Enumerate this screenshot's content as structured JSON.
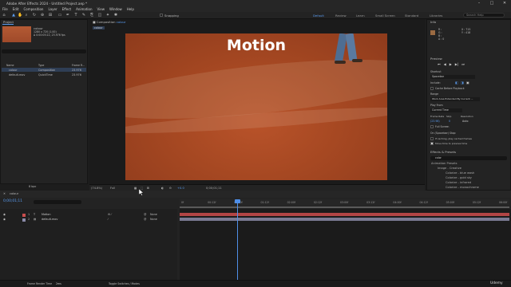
{
  "window": {
    "title": "Adobe After Effects 2024 - Untitled Project.aep *"
  },
  "menu": [
    "File",
    "Edit",
    "Composition",
    "Layer",
    "Effect",
    "Animation",
    "View",
    "Window",
    "Help"
  ],
  "toolbar": {
    "snapping": "Snapping",
    "workspaces": [
      "Default",
      "Review",
      "Learn",
      "Small Screen",
      "Standard",
      "Libraries"
    ],
    "active_workspace": "Default",
    "search_help": "Search Help"
  },
  "project": {
    "title": "Project",
    "comp_name": "colour",
    "comp_info_1": "1280 x 720 (1.00)",
    "comp_info_2": "Δ 0:00:05:22, 23.976 fps",
    "columns": [
      "Name",
      "Type",
      "Frame R..."
    ],
    "items": [
      {
        "name": "colour",
        "type": "Composition",
        "fps": "23.976"
      },
      {
        "name": "default.mov",
        "type": "QuickTime",
        "fps": "23.976"
      }
    ],
    "bpc": "8 bpc"
  },
  "composition": {
    "tab": "Composition",
    "comp_name": "colour",
    "crumb": "colour",
    "overlay_text": "Motion"
  },
  "viewer": {
    "zoom": "(74.8%)",
    "quality": "Full",
    "timecode": "0;00;01;11",
    "exposure": "+0.0"
  },
  "info": {
    "title": "Info",
    "r": "R :",
    "g": "G :",
    "b": "B :",
    "a": "A : 0",
    "x": "X : 715",
    "y": "Y : 418"
  },
  "preview": {
    "title": "Preview",
    "shortcut_label": "Shortcut",
    "shortcut_value": "Spacebar",
    "include": "Include:",
    "cache": "Cache Before Playback",
    "range_label": "Range",
    "range_value": "Work Area Extended By Current ...",
    "play_from_label": "Play From",
    "play_from_value": "Current Time",
    "frame_rate_label": "Frame Rate",
    "skip_label": "Skip",
    "resolution_label": "Resolution",
    "frame_rate": "(23.98)",
    "skip": "0",
    "resolution": "Auto",
    "full_screen": "Full Screen",
    "on_stop": "On (Spacebar) Stop:",
    "if_caching": "If caching, play cached frames",
    "move_time": "Move time to preview time"
  },
  "effects": {
    "title": "Effects & Presets",
    "search": "color",
    "tree": [
      "Animation Presets",
      "Image - Creative",
      "Colorize - blue wash",
      "Colorize - gold sky",
      "Colorize - infrared",
      "Colorize - monochrome"
    ]
  },
  "timeline": {
    "tab": "colour",
    "timecode": "0;00;01;11",
    "columns": [
      "Source Name",
      "Parent & Link"
    ],
    "layers": [
      {
        "num": "1",
        "name": "Motion",
        "parent": "None",
        "color": "#c94d4d"
      },
      {
        "num": "2",
        "name": "default.mov",
        "parent": "None",
        "color": "#8a8aa8"
      }
    ],
    "ticks": [
      "0f",
      "00:12f",
      "01:00f",
      "01:12f",
      "02:00f",
      "02:12f",
      "03:00f",
      "03:12f",
      "04:00f",
      "04:12f",
      "05:00f",
      "05:12f",
      "06:00f"
    ],
    "frame_render_time_label": "Frame Render Time",
    "frame_render_time": "2ms",
    "toggle": "Toggle Switches / Modes"
  },
  "branding": {
    "udemy": "Udemy"
  }
}
